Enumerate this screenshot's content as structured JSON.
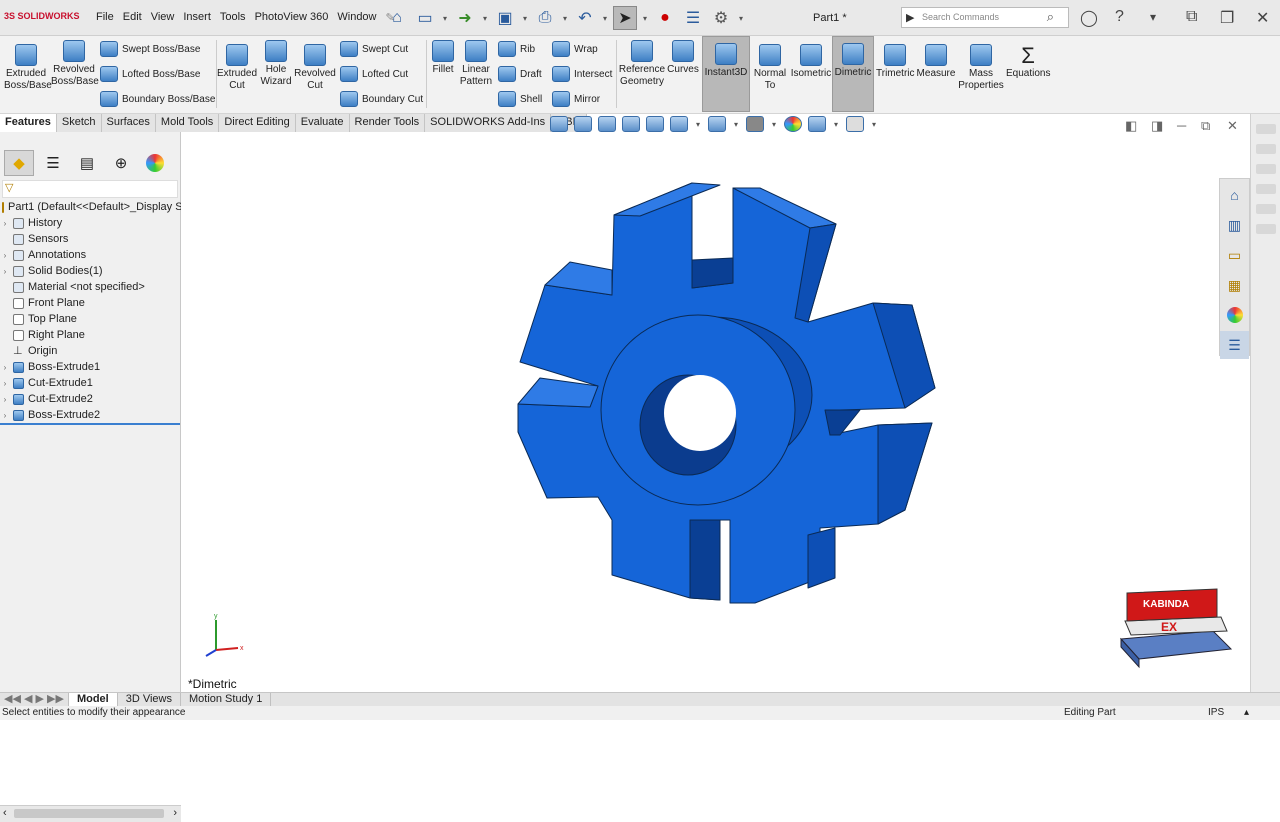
{
  "app": {
    "logo": "SOLIDWORKS",
    "document_title": "Part1 *"
  },
  "menu": [
    "File",
    "Edit",
    "View",
    "Insert",
    "Tools",
    "PhotoView 360",
    "Window"
  ],
  "search": {
    "placeholder": "Search Commands"
  },
  "ribbon": {
    "extruded_boss": "Extruded\nBoss/Base",
    "revolved_boss": "Revolved\nBoss/Base",
    "swept_boss": "Swept Boss/Base",
    "lofted_boss": "Lofted Boss/Base",
    "boundary_boss": "Boundary Boss/Base",
    "extruded_cut": "Extruded\nCut",
    "hole_wizard": "Hole\nWizard",
    "revolved_cut": "Revolved\nCut",
    "swept_cut": "Swept Cut",
    "lofted_cut": "Lofted Cut",
    "boundary_cut": "Boundary Cut",
    "fillet": "Fillet",
    "linear_pattern": "Linear\nPattern",
    "rib": "Rib",
    "draft": "Draft",
    "shell": "Shell",
    "wrap": "Wrap",
    "intersect": "Intersect",
    "mirror": "Mirror",
    "reference_geometry": "Reference\nGeometry",
    "curves": "Curves",
    "instant3d": "Instant3D",
    "normal_to": "Normal\nTo",
    "isometric": "Isometric",
    "dimetric": "Dimetric",
    "trimetric": "Trimetric",
    "measure": "Measure",
    "mass_properties": "Mass\nProperties",
    "equations": "Equations"
  },
  "tabs": [
    "Features",
    "Sketch",
    "Surfaces",
    "Mold Tools",
    "Direct Editing",
    "Evaluate",
    "Render Tools",
    "SOLIDWORKS Add-Ins",
    "MBD"
  ],
  "tree": {
    "root": "Part1  (Default<<Default>_Display S",
    "items": [
      "History",
      "Sensors",
      "Annotations",
      "Solid Bodies(1)",
      "Material <not specified>",
      "Front Plane",
      "Top Plane",
      "Right Plane",
      "Origin",
      "Boss-Extrude1",
      "Cut-Extrude1",
      "Cut-Extrude2",
      "Boss-Extrude2"
    ]
  },
  "viewport": {
    "view_name": "*Dimetric",
    "model_color": "#1565d8"
  },
  "triad": {
    "x": "x",
    "y": "y"
  },
  "bottom_tabs": [
    "Model",
    "3D Views",
    "Motion Study 1"
  ],
  "status": {
    "message": "Select entities to modify their appearance",
    "mode": "Editing Part",
    "units": "IPS"
  },
  "watermark": {
    "top": "KABINDA",
    "bottom": "EX"
  }
}
